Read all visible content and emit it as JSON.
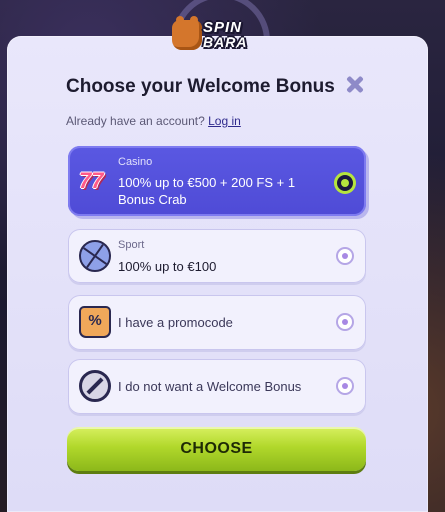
{
  "logo": {
    "line1": "SPIN",
    "line2": "BARA"
  },
  "modal": {
    "title": "Choose your Welcome Bonus",
    "account_prompt": "Already have an account?",
    "login_link": "Log in",
    "close_icon": "close-icon"
  },
  "options": [
    {
      "category": "Casino",
      "text": "100% up to €500 + 200 FS + 1 Bonus Crab",
      "icon": "casino-777-icon",
      "selected": true
    },
    {
      "category": "Sport",
      "text": "100% up to €100",
      "icon": "basketball-icon",
      "selected": false
    },
    {
      "category": "",
      "text": "I have a promocode",
      "icon": "promo-bag-icon",
      "selected": false
    },
    {
      "category": "",
      "text": "I do not want a Welcome Bonus",
      "icon": "no-bonus-icon",
      "selected": false
    }
  ],
  "casino_icon_text": "77",
  "promo_icon_text": "%",
  "choose_button": "CHOOSE",
  "colors": {
    "accent": "#4f4bd6",
    "cta": "#b1d82b",
    "radio": "#a889e4"
  }
}
